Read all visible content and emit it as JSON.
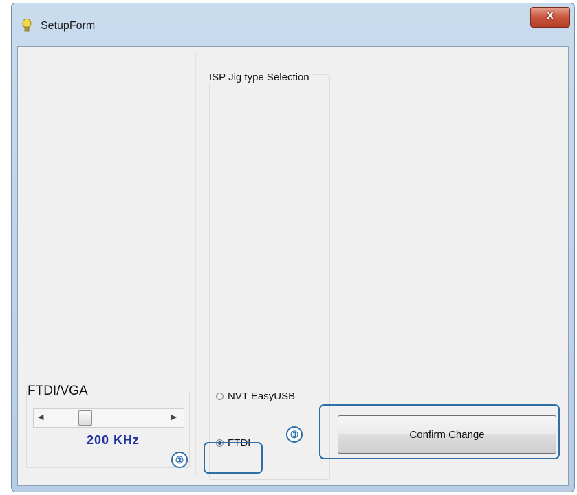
{
  "window": {
    "title": "SetupForm",
    "close_label": "X"
  },
  "speed": {
    "label": "FTDI/VGA",
    "value": "200  KHz",
    "slider_position": 0.35
  },
  "jig_group": {
    "title": "ISP Jig type Selection",
    "options": [
      {
        "label": "NVT EasyUSB",
        "checked": false
      },
      {
        "label": "FTDI",
        "checked": true
      }
    ]
  },
  "confirm_button": {
    "label": "Confirm Change"
  },
  "callouts": {
    "ftdi_marker": "②",
    "confirm_marker": "③",
    "color": "#2e6fa8"
  }
}
